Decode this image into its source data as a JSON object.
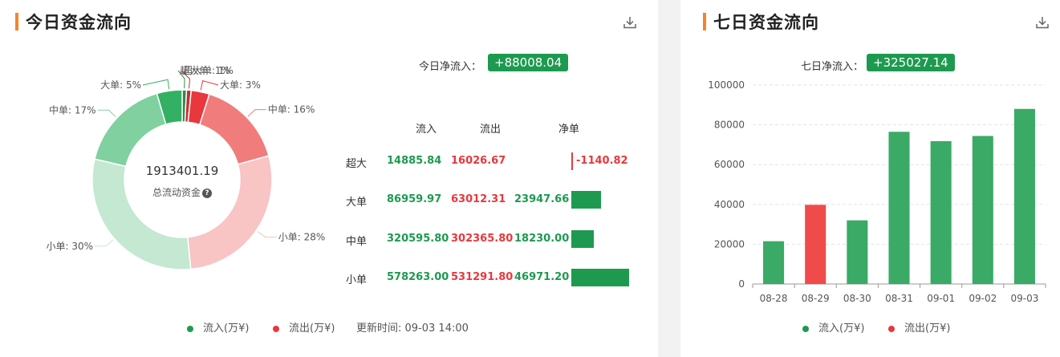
{
  "left_panel": {
    "title": "今日资金流向",
    "net_label": "今日净流入：",
    "net_value": "+88008.04",
    "center_value": "1913401.19",
    "center_label": "总流动资金",
    "headers": {
      "in": "流入",
      "out": "流出",
      "net": "净单"
    },
    "rows": [
      {
        "label": "超大",
        "in": "14885.84",
        "out": "16026.67",
        "net": "-1140.82",
        "net_num": -1140.82
      },
      {
        "label": "大单",
        "in": "86959.97",
        "out": "63012.31",
        "net": "23947.66",
        "net_num": 23947.66
      },
      {
        "label": "中单",
        "in": "320595.80",
        "out": "302365.80",
        "net": "18230.00",
        "net_num": 18230.0
      },
      {
        "label": "小单",
        "in": "578263.00",
        "out": "531291.80",
        "net": "46971.20",
        "net_num": 46971.2
      }
    ],
    "legend": {
      "in": "流入(万¥)",
      "out": "流出(万¥)",
      "update": "更新时间: 09-03 14:00"
    }
  },
  "right_panel": {
    "title": "七日资金流向",
    "net_label": "七日净流入：",
    "net_value": "+325027.14",
    "legend": {
      "in": "流入(万¥)",
      "out": "流出(万¥)"
    }
  },
  "colors": {
    "accent": "#f5842a",
    "green": "#1d9a4f",
    "red": "#e8383d",
    "bar_green": "#3aaa66",
    "bar_red": "#ef4b4b"
  },
  "icons": {
    "download": "download-icon",
    "help": "question-circle-icon"
  },
  "chart_data": [
    {
      "type": "pie",
      "title": "",
      "center_value": "1913401.19",
      "slices": [
        {
          "name": "超大单",
          "value": 14885.84,
          "label": "超大单: 1%",
          "color": "#2e8a4e"
        },
        {
          "name": "超大单",
          "value": 16026.67,
          "label": "超大单: 1%",
          "color": "#c62f2f"
        },
        {
          "name": "大单",
          "value": 63012.31,
          "label": "大单: 3%",
          "color": "#e8383d"
        },
        {
          "name": "中单",
          "value": 302365.8,
          "label": "中单: 16%",
          "color": "#f07c7c"
        },
        {
          "name": "小单",
          "value": 531291.8,
          "label": "小单: 28%",
          "color": "#f8c4c4"
        },
        {
          "name": "小单",
          "value": 578263.0,
          "label": "小单: 30%",
          "color": "#c4e8d2"
        },
        {
          "name": "中单",
          "value": 320595.8,
          "label": "中单: 17%",
          "color": "#80d0a0"
        },
        {
          "name": "大单",
          "value": 86959.97,
          "label": "大单: 5%",
          "color": "#34b064"
        }
      ]
    },
    {
      "type": "bar",
      "categories": [
        "08-28",
        "08-29",
        "08-30",
        "08-31",
        "09-01",
        "09-02",
        "09-03"
      ],
      "values": [
        21500,
        39800,
        32000,
        76500,
        71800,
        74400,
        88000
      ],
      "colors": [
        "#3aaa66",
        "#ef4b4b",
        "#3aaa66",
        "#3aaa66",
        "#3aaa66",
        "#3aaa66",
        "#3aaa66"
      ],
      "yticks": [
        0,
        20000,
        40000,
        60000,
        80000,
        100000
      ],
      "ylim": [
        0,
        100000
      ],
      "grid": true,
      "xlabel": "",
      "ylabel": ""
    }
  ]
}
